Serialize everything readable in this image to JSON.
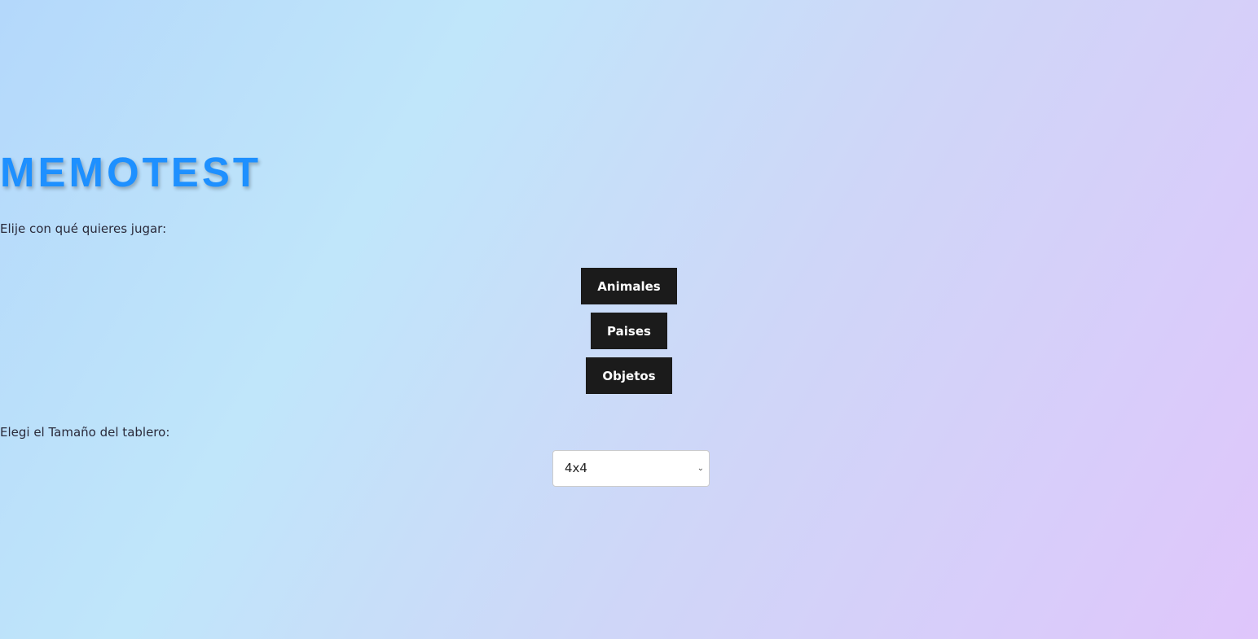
{
  "title": "MEMOTEST",
  "prompt": "Elije con qué quieres jugar:",
  "categories": [
    "Animales",
    "Paises",
    "Objetos"
  ],
  "size_label": "Elegi el Tamaño del tablero:",
  "size_select": {
    "value": "4x4"
  }
}
